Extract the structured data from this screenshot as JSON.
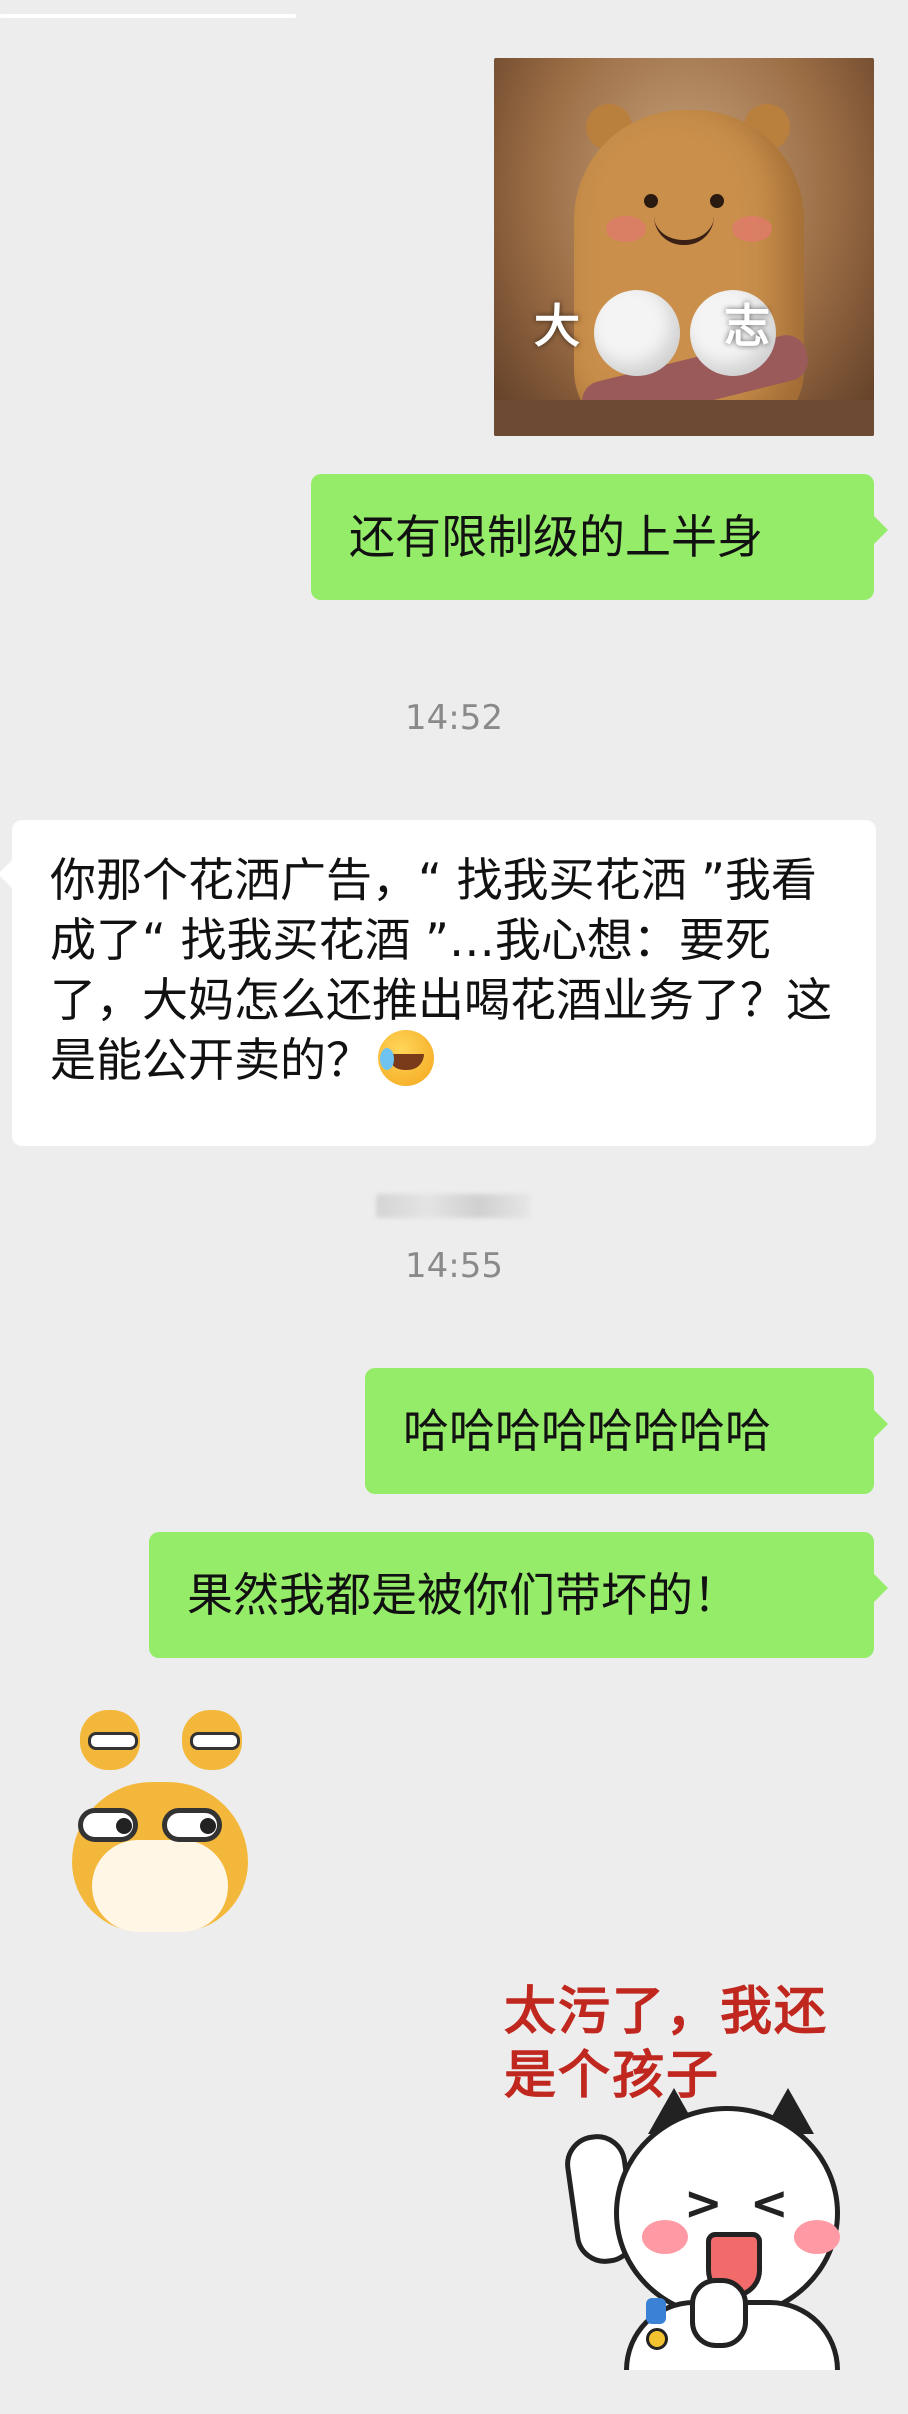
{
  "sticker_bear": {
    "caption": "大 志"
  },
  "messages": [
    {
      "side": "me",
      "text": "还有限制级的上半身"
    },
    {
      "side": "other",
      "text": "你那个花洒广告，“ 找我买花洒 ”我看成了“ 找我买花酒 ”…我心想：要死了，大妈怎么还推出喝花酒业务了？这是能公开卖的？"
    },
    {
      "side": "me",
      "text": "哈哈哈哈哈哈哈哈"
    },
    {
      "side": "me",
      "text": "果然我都是被你们带坏的！"
    }
  ],
  "timestamps": [
    "14:52",
    "14:55"
  ],
  "emoji": {
    "name": "laugh-cry-emoji-icon"
  },
  "sticker_cat": {
    "text": "太污了，我还是个孩子"
  },
  "icons": [
    "bear-sticker-icon",
    "dog-sticker-icon",
    "cat-sticker-icon"
  ],
  "colors": {
    "background": "#ededed",
    "my_bubble": "#95ec69",
    "other_bubble": "#ffffff",
    "timestamp": "#8a8a8a"
  }
}
